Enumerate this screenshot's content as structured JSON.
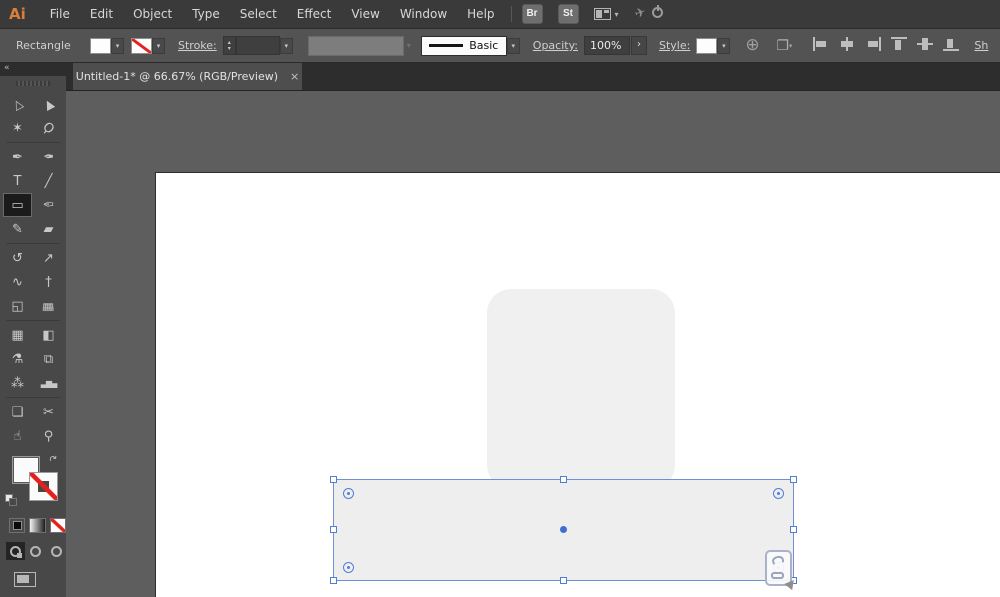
{
  "colors": {
    "accent_logo": "#d97f3a",
    "selection_blue": "#4f7ed9",
    "none_red": "#e2211c",
    "shape_fill": "#f0f0f0",
    "artboard": "#ffffff",
    "canvas": "#5e5e5e"
  },
  "menubar": {
    "logo": "Ai",
    "items": [
      "File",
      "Edit",
      "Object",
      "Type",
      "Select",
      "Effect",
      "View",
      "Window",
      "Help"
    ],
    "bridge_label": "Br",
    "stock_label": "St",
    "workspace_icon": "workspace-switcher-icon",
    "gpu_icon": "gpu-performance-icon"
  },
  "controlbar": {
    "tool_label": "Rectangle",
    "fill_swatch": "#ffffff",
    "stroke_swatch": "none",
    "stroke_label": "Stroke:",
    "stroke_weight_value": "",
    "brush_name": "Basic",
    "opacity_label": "Opacity:",
    "opacity_value": "100%",
    "more_glyph": "›",
    "style_label": "Style:",
    "globe_glyph": "⊕",
    "docsetup_glyph": "❐",
    "chevron_glyph": "▾",
    "stepper_up": "▴",
    "stepper_down": "▾",
    "align_icons": [
      {
        "name": "horizontal-align-left-icon",
        "k": "al-left"
      },
      {
        "name": "horizontal-align-center-icon",
        "k": "al-hcenter"
      },
      {
        "name": "horizontal-align-right-icon",
        "k": "al-right"
      },
      {
        "name": "vertical-align-top-icon",
        "k": "al-top"
      },
      {
        "name": "vertical-align-center-icon",
        "k": "al-vcenter"
      },
      {
        "name": "vertical-align-bottom-icon",
        "k": "al-bottom"
      }
    ],
    "partial_label": "Sh"
  },
  "tab": {
    "title": "Untitled-1* @ 66.67% (RGB/Preview)",
    "close_glyph": "×"
  },
  "panel": {
    "collapse_glyph": "«",
    "swap_glyph": "↷",
    "fill_value": "#ffffff",
    "stroke_value": "none"
  },
  "tools": {
    "groups": [
      [
        [
          {
            "name": "selection-tool",
            "glyph": "△",
            "cls": "arrow"
          },
          {
            "name": "direct-selection-tool",
            "glyph": "▲",
            "cls": "arrow"
          }
        ],
        [
          {
            "name": "magic-wand-tool",
            "glyph": "✶"
          },
          {
            "name": "lasso-tool",
            "glyph": "Ϙ",
            "cls": "rot45"
          }
        ]
      ],
      [
        [
          {
            "name": "pen-tool",
            "glyph": "✒"
          },
          {
            "name": "curvature-tool",
            "glyph": "✒",
            "cls": "fliph"
          }
        ],
        [
          {
            "name": "type-tool",
            "glyph": "T"
          },
          {
            "name": "line-segment-tool",
            "glyph": "╱"
          }
        ],
        [
          {
            "name": "rectangle-tool",
            "glyph": "▭",
            "selected": true
          },
          {
            "name": "paintbrush-tool",
            "glyph": "✑",
            "cls": "fliph"
          }
        ],
        [
          {
            "name": "shaper-tool",
            "glyph": "✎"
          },
          {
            "name": "eraser-tool",
            "glyph": "▰"
          }
        ]
      ],
      [
        [
          {
            "name": "rotate-tool",
            "glyph": "↺"
          },
          {
            "name": "scale-tool",
            "glyph": "↗"
          }
        ],
        [
          {
            "name": "width-tool",
            "glyph": "∿"
          },
          {
            "name": "puppet-warp-tool",
            "glyph": "†"
          }
        ],
        [
          {
            "name": "shape-builder-tool",
            "glyph": "◱"
          },
          {
            "name": "perspective-grid-tool",
            "glyph": "▦",
            "cls": "persp"
          }
        ]
      ],
      [
        [
          {
            "name": "mesh-tool",
            "glyph": "▦"
          },
          {
            "name": "gradient-tool",
            "glyph": "◧"
          }
        ],
        [
          {
            "name": "eyedropper-tool",
            "glyph": "⚗"
          },
          {
            "name": "blend-tool",
            "glyph": "⧉"
          }
        ],
        [
          {
            "name": "symbol-sprayer-tool",
            "glyph": "⁂"
          },
          {
            "name": "column-graph-tool",
            "glyph": "▃▆▄",
            "cls": "bars"
          }
        ]
      ],
      [
        [
          {
            "name": "artboard-tool",
            "glyph": "❏"
          },
          {
            "name": "slice-tool",
            "glyph": "✂"
          }
        ],
        [
          {
            "name": "hand-tool",
            "glyph": "☝"
          },
          {
            "name": "zoom-tool",
            "glyph": "⚲"
          }
        ]
      ]
    ]
  },
  "canvas_objects": {
    "selected_shape": "rectangle",
    "background_shape": "rounded-rectangle",
    "cursor": "rectangle-tool-cursor"
  }
}
